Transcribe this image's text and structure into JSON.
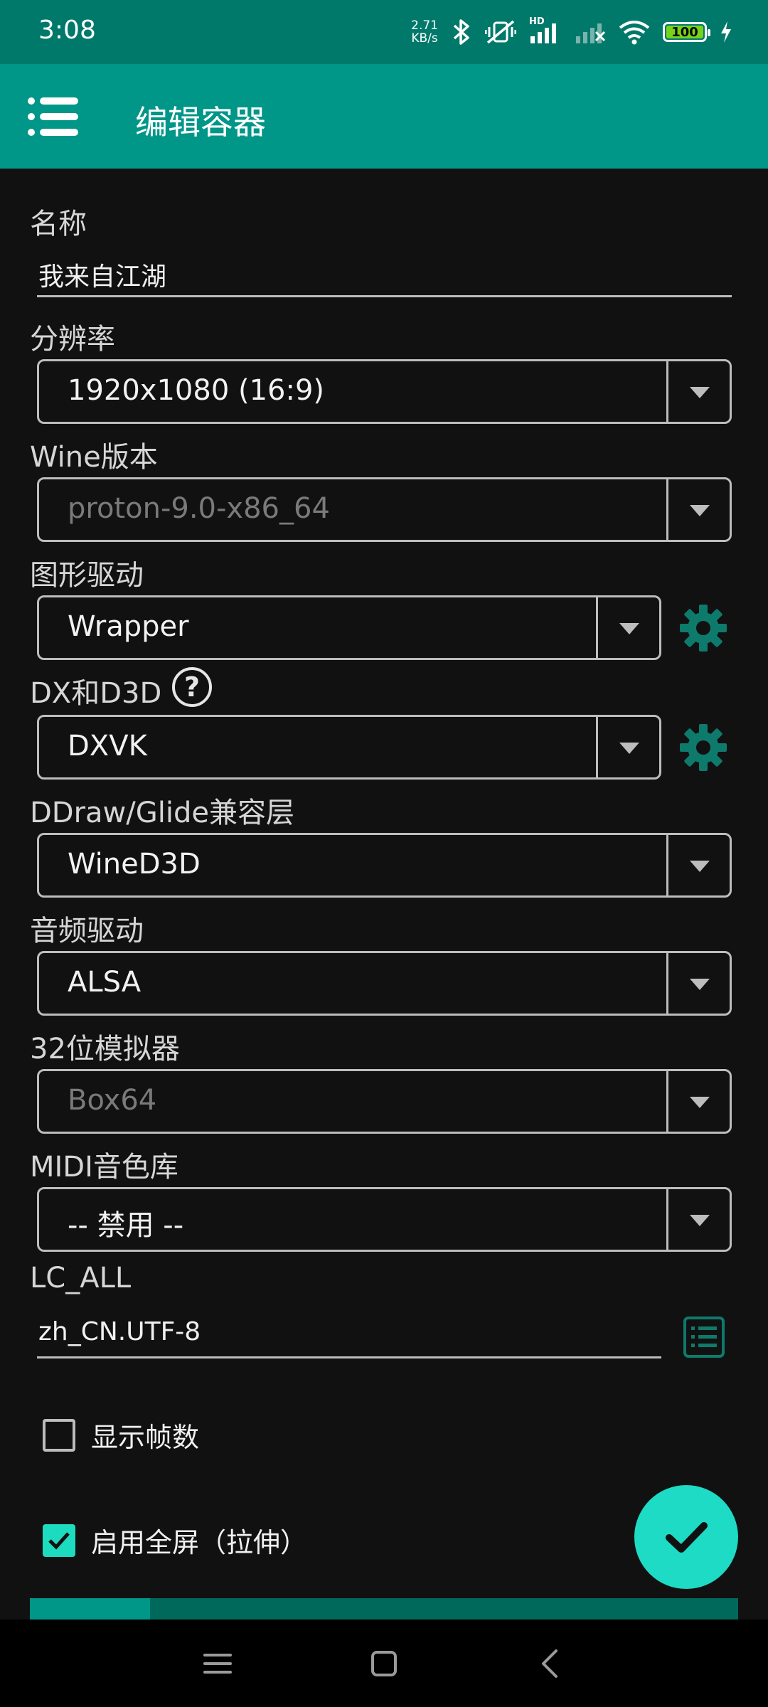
{
  "status_bar": {
    "time": "3:08",
    "net_speed_value": "2.71",
    "net_speed_unit": "KB/s",
    "signal_label": "HD",
    "battery": "100"
  },
  "app_bar": {
    "title": "编辑容器"
  },
  "form": {
    "name_label": "名称",
    "name_value": "我来自江湖",
    "resolution_label": "分辨率",
    "resolution_value": "1920x1080 (16:9)",
    "wine_label": "Wine版本",
    "wine_value": "proton-9.0-x86_64",
    "graphics_label": "图形驱动",
    "graphics_value": "Wrapper",
    "dx_label": "DX和D3D",
    "dx_value": "DXVK",
    "ddraw_label": "DDraw/Glide兼容层",
    "ddraw_value": "WineD3D",
    "audio_label": "音频驱动",
    "audio_value": "ALSA",
    "emulator_label": "32位模拟器",
    "emulator_value": "Box64",
    "midi_label": "MIDI音色库",
    "midi_value": "-- 禁用 --",
    "lc_all_label": "LC_ALL",
    "lc_all_value": "zh_CN.UTF-8",
    "show_fps_label": "显示帧数",
    "show_fps_checked": false,
    "fullscreen_label": "启用全屏（拉伸）",
    "fullscreen_checked": true
  },
  "progress": {
    "fraction": 0.17
  },
  "colors": {
    "status_bar": "#00796b",
    "app_bar": "#009688",
    "accent": "#1ddbc4",
    "gear": "#0e7a6c"
  },
  "icons": {
    "menu": "menu-icon",
    "help": "help-icon",
    "gear": "gear-icon",
    "list": "list-icon",
    "check": "check-icon"
  }
}
